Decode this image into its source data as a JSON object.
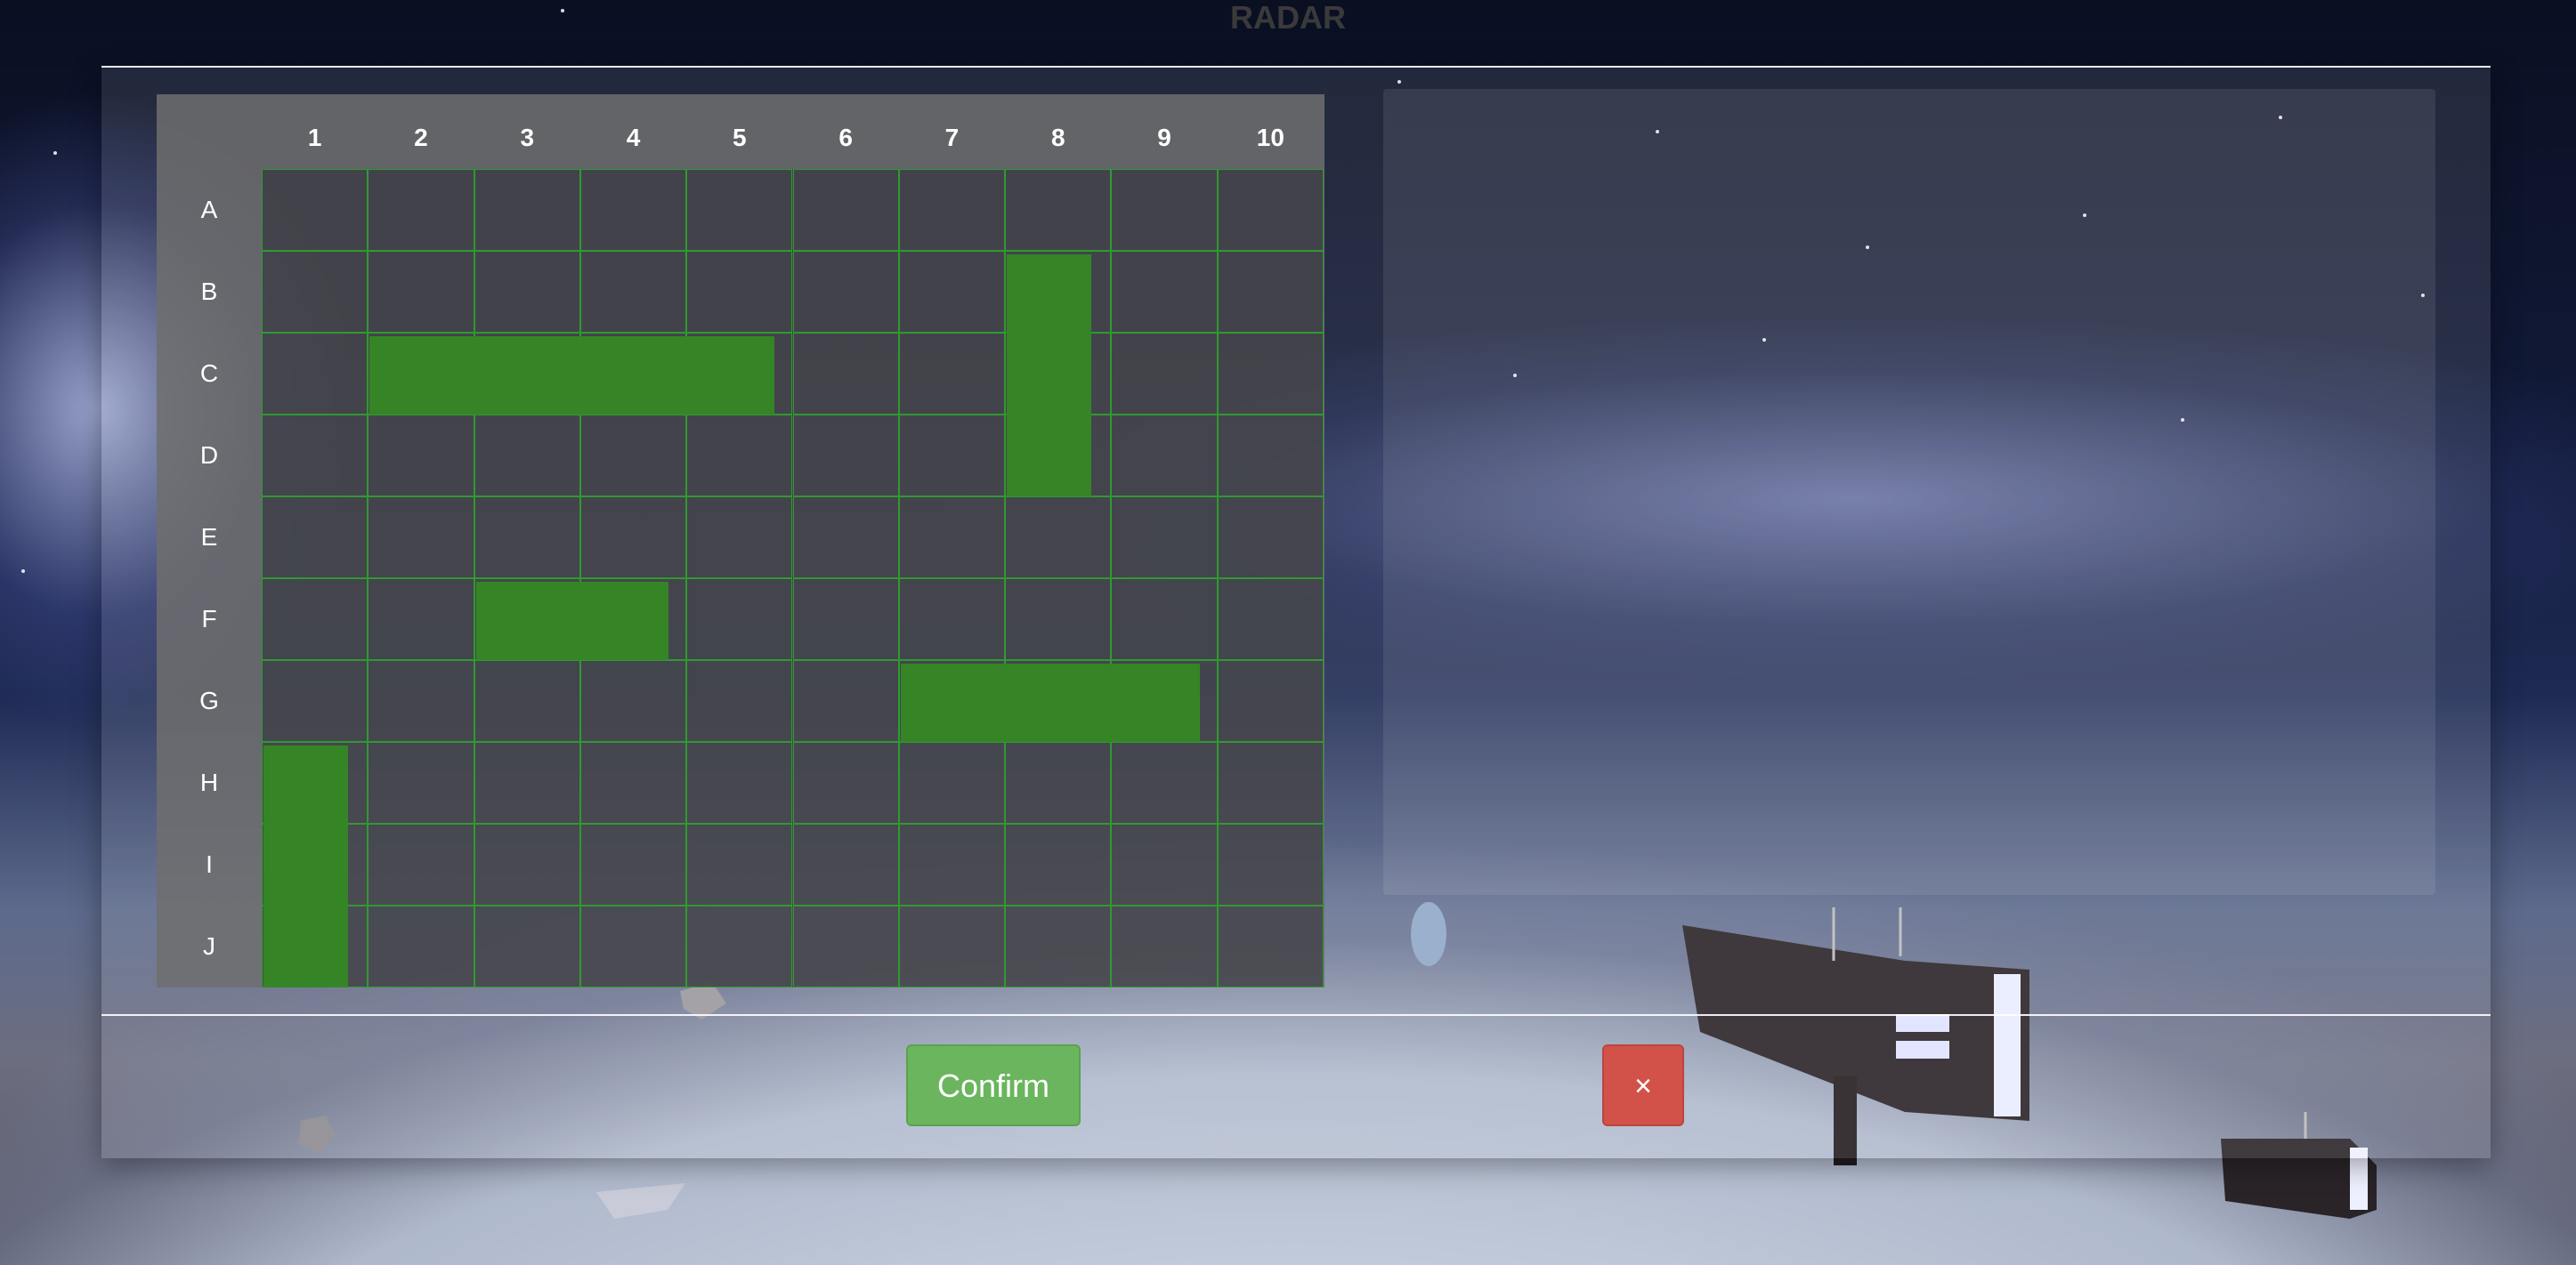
{
  "title": "RADAR",
  "board": {
    "columns": [
      "1",
      "2",
      "3",
      "4",
      "5",
      "6",
      "7",
      "8",
      "9",
      "10"
    ],
    "rows": [
      "A",
      "B",
      "C",
      "D",
      "E",
      "F",
      "G",
      "H",
      "I",
      "J"
    ],
    "grid_color": "#2f9a2f",
    "ship_color": "#358526",
    "ships": [
      {
        "row": 2,
        "col": 1,
        "length": 4,
        "orientation": "horizontal"
      },
      {
        "row": 1,
        "col": 7,
        "length": 3,
        "orientation": "vertical"
      },
      {
        "row": 5,
        "col": 2,
        "length": 2,
        "orientation": "horizontal"
      },
      {
        "row": 6,
        "col": 6,
        "length": 3,
        "orientation": "horizontal"
      },
      {
        "row": 7,
        "col": 0,
        "length": 3,
        "orientation": "vertical"
      }
    ]
  },
  "actions": {
    "confirm_label": "Confirm",
    "close_label": "×",
    "confirm_color": "#6ab55e",
    "close_color": "#d2524a"
  }
}
